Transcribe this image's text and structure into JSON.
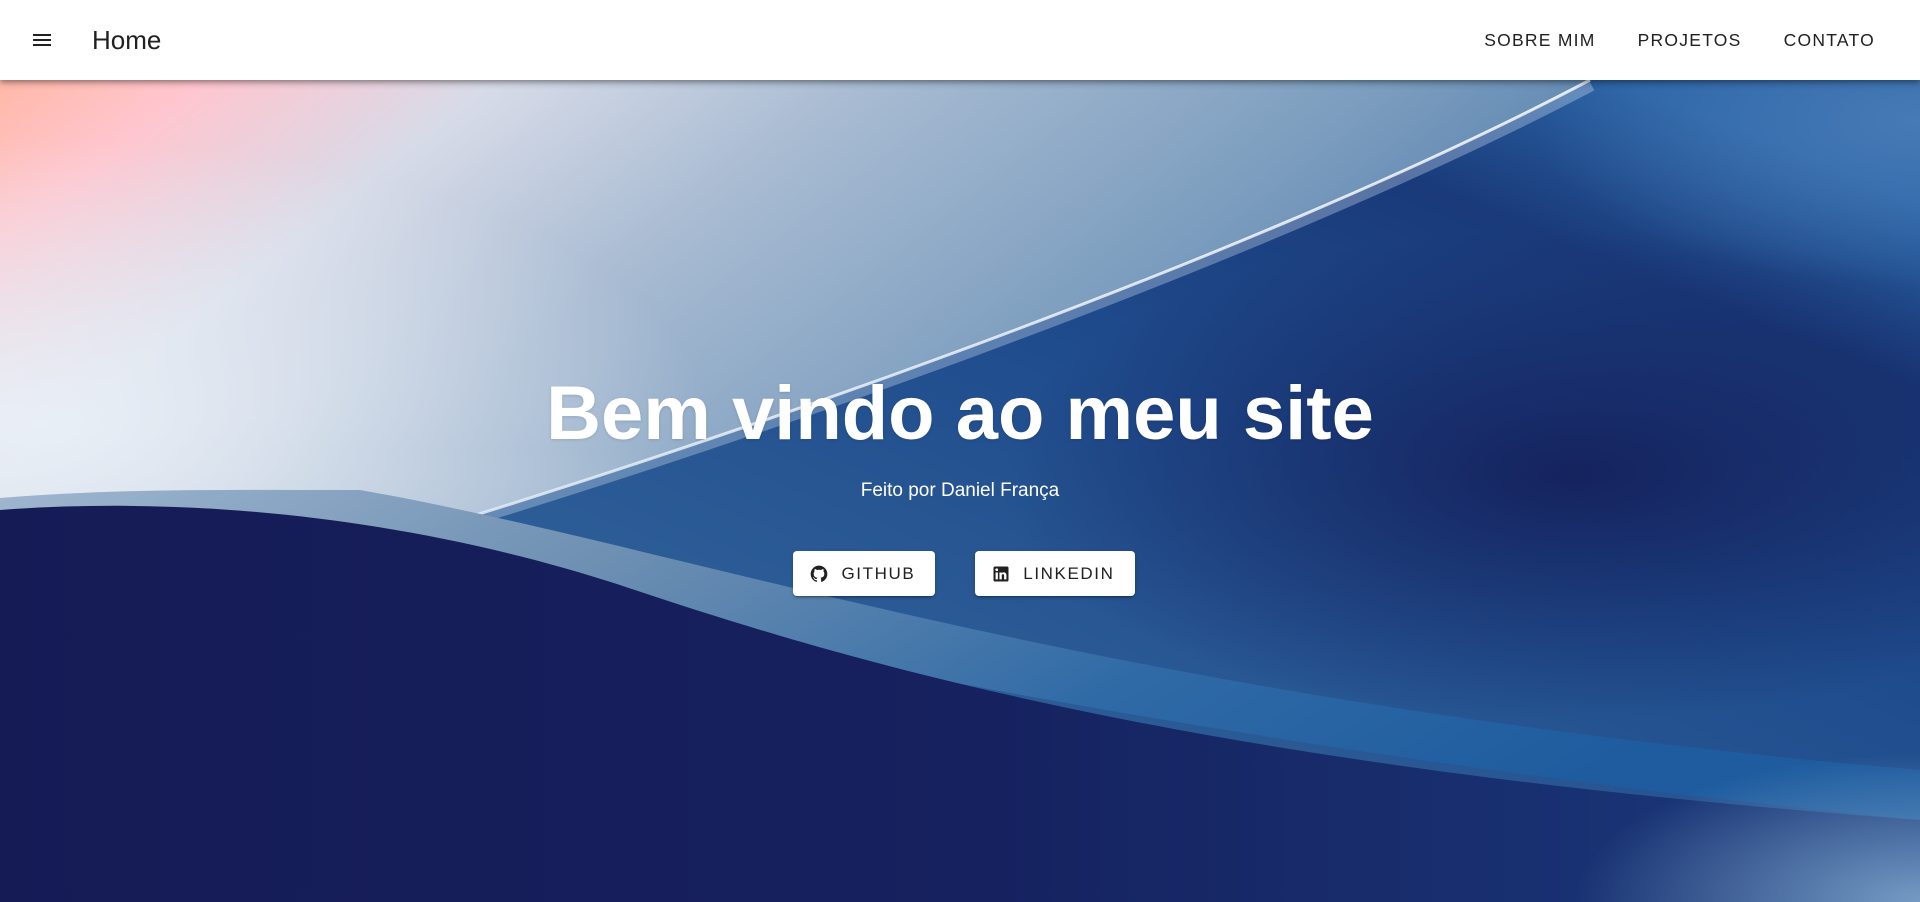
{
  "appbar": {
    "menu_icon": "hamburger-menu-icon",
    "title": "Home",
    "nav": [
      {
        "label": "SOBRE MIM"
      },
      {
        "label": "PROJETOS"
      },
      {
        "label": "CONTATO"
      }
    ]
  },
  "hero": {
    "headline": "Bem vindo ao meu site",
    "subtitle": "Feito por Daniel França",
    "buttons": [
      {
        "label": "GITHUB",
        "icon": "github-icon"
      },
      {
        "label": "LINKEDIN",
        "icon": "linkedin-icon"
      }
    ]
  },
  "colors": {
    "appbar": "#ffffff",
    "text_dark": "#212121",
    "hero_text": "#ffffff",
    "hero_navy": "#151d57",
    "hero_blue": "#1d5aa0",
    "hero_peach": "#ffc0b3"
  }
}
